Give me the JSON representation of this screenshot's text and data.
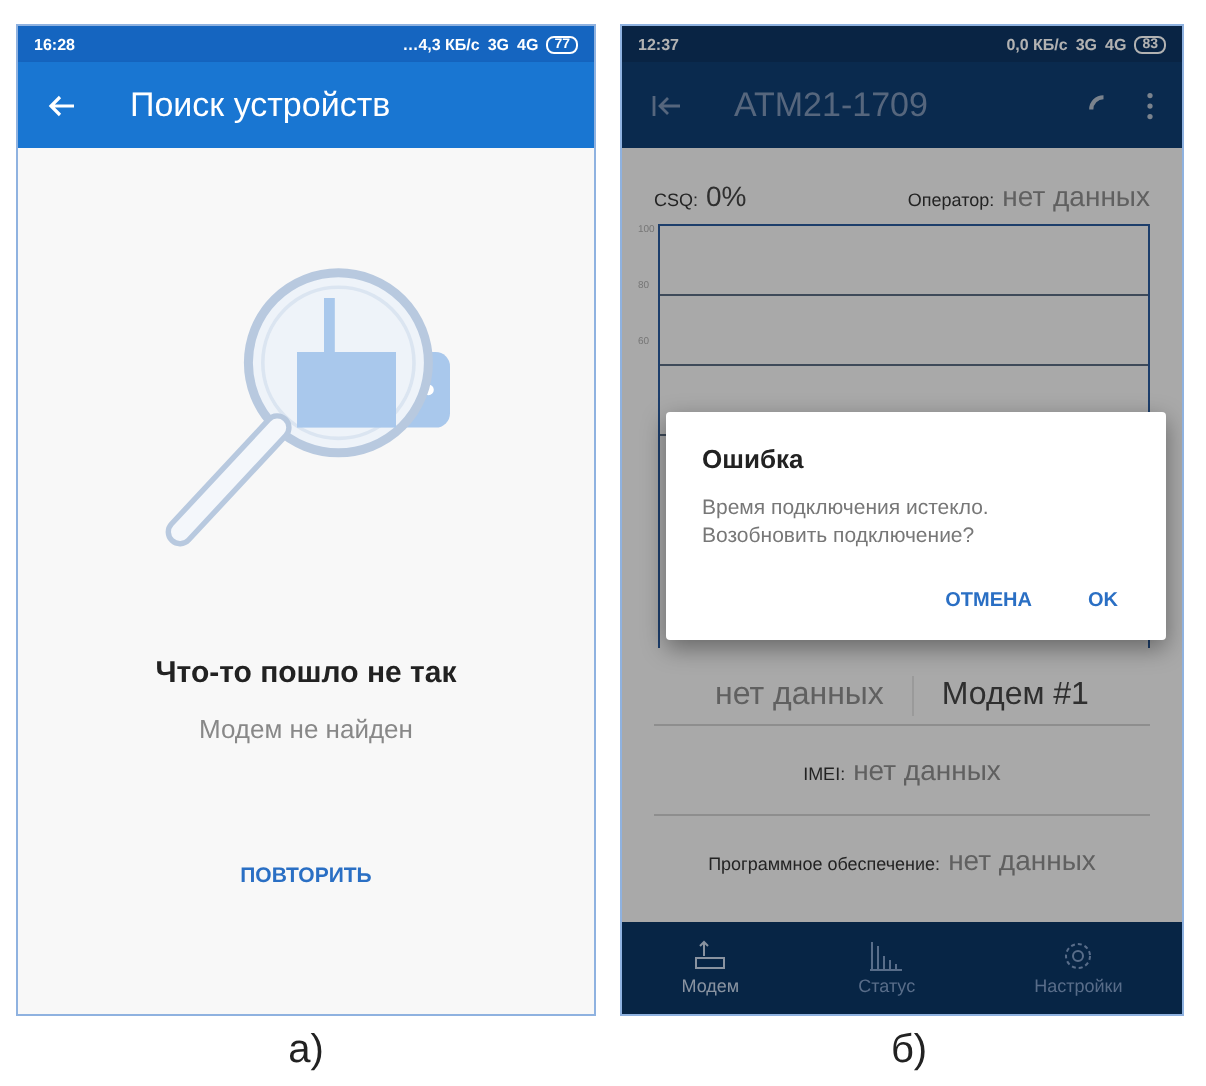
{
  "screen_a": {
    "status_bar": {
      "time": "16:28",
      "speed": "…4,3 КБ/с",
      "networks": [
        "3G",
        "4G"
      ],
      "battery": "77"
    },
    "app_bar": {
      "title": "Поиск устройств"
    },
    "message": {
      "title": "Что-то пошло не так",
      "subtitle": "Модем не найден"
    },
    "retry_button": "ПОВТОРИТЬ",
    "caption": "а)"
  },
  "screen_b": {
    "status_bar": {
      "time": "12:37",
      "speed": "0,0 КБ/с",
      "networks": [
        "3G",
        "4G"
      ],
      "battery": "83"
    },
    "app_bar": {
      "title": "АТМ21-1709"
    },
    "csq": {
      "label": "CSQ:",
      "value": "0%"
    },
    "operator": {
      "label": "Оператор:",
      "value": "нет данных"
    },
    "chart_ticks": [
      "100",
      "80",
      "60"
    ],
    "modem_row": {
      "left": "нет данных",
      "right": "Модем #1"
    },
    "imei": {
      "label": "IMEI:",
      "value": "нет данных"
    },
    "firmware": {
      "label": "Программное обеспечение:",
      "value": "нет данных"
    },
    "dialog": {
      "title": "Ошибка",
      "text": "Время подключения истекло. Возобновить подключение?",
      "buttons": [
        "ОТМЕНА",
        "OK"
      ]
    },
    "bottom_nav": [
      {
        "label": "Модем",
        "kind": "modem",
        "selected": true
      },
      {
        "label": "Статус",
        "kind": "chart",
        "selected": false
      },
      {
        "label": "Настройки",
        "kind": "gear",
        "selected": false
      }
    ],
    "caption": "б)"
  }
}
